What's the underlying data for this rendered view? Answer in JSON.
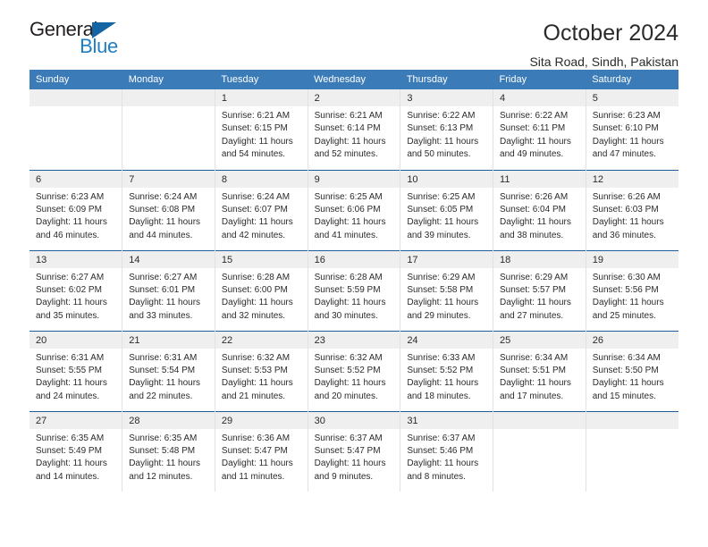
{
  "brand": {
    "name_top": "General",
    "name_bottom": "Blue",
    "triangle_color": "#1264a3",
    "text_color": "#231f20",
    "accent_color": "#1f7fc4"
  },
  "header": {
    "title": "October 2024",
    "location": "Sita Road, Sindh, Pakistan"
  },
  "theme": {
    "header_row_bg": "#3b7cb8",
    "header_row_text": "#ffffff",
    "week_divider": "#1f5e9e",
    "daynum_band_bg": "#efefef",
    "cell_text": "#2b2b2b"
  },
  "weekdays": [
    "Sunday",
    "Monday",
    "Tuesday",
    "Wednesday",
    "Thursday",
    "Friday",
    "Saturday"
  ],
  "weeks": [
    [
      {
        "day": "",
        "lines": []
      },
      {
        "day": "",
        "lines": []
      },
      {
        "day": "1",
        "lines": [
          "Sunrise: 6:21 AM",
          "Sunset: 6:15 PM",
          "Daylight: 11 hours",
          "and 54 minutes."
        ]
      },
      {
        "day": "2",
        "lines": [
          "Sunrise: 6:21 AM",
          "Sunset: 6:14 PM",
          "Daylight: 11 hours",
          "and 52 minutes."
        ]
      },
      {
        "day": "3",
        "lines": [
          "Sunrise: 6:22 AM",
          "Sunset: 6:13 PM",
          "Daylight: 11 hours",
          "and 50 minutes."
        ]
      },
      {
        "day": "4",
        "lines": [
          "Sunrise: 6:22 AM",
          "Sunset: 6:11 PM",
          "Daylight: 11 hours",
          "and 49 minutes."
        ]
      },
      {
        "day": "5",
        "lines": [
          "Sunrise: 6:23 AM",
          "Sunset: 6:10 PM",
          "Daylight: 11 hours",
          "and 47 minutes."
        ]
      }
    ],
    [
      {
        "day": "6",
        "lines": [
          "Sunrise: 6:23 AM",
          "Sunset: 6:09 PM",
          "Daylight: 11 hours",
          "and 46 minutes."
        ]
      },
      {
        "day": "7",
        "lines": [
          "Sunrise: 6:24 AM",
          "Sunset: 6:08 PM",
          "Daylight: 11 hours",
          "and 44 minutes."
        ]
      },
      {
        "day": "8",
        "lines": [
          "Sunrise: 6:24 AM",
          "Sunset: 6:07 PM",
          "Daylight: 11 hours",
          "and 42 minutes."
        ]
      },
      {
        "day": "9",
        "lines": [
          "Sunrise: 6:25 AM",
          "Sunset: 6:06 PM",
          "Daylight: 11 hours",
          "and 41 minutes."
        ]
      },
      {
        "day": "10",
        "lines": [
          "Sunrise: 6:25 AM",
          "Sunset: 6:05 PM",
          "Daylight: 11 hours",
          "and 39 minutes."
        ]
      },
      {
        "day": "11",
        "lines": [
          "Sunrise: 6:26 AM",
          "Sunset: 6:04 PM",
          "Daylight: 11 hours",
          "and 38 minutes."
        ]
      },
      {
        "day": "12",
        "lines": [
          "Sunrise: 6:26 AM",
          "Sunset: 6:03 PM",
          "Daylight: 11 hours",
          "and 36 minutes."
        ]
      }
    ],
    [
      {
        "day": "13",
        "lines": [
          "Sunrise: 6:27 AM",
          "Sunset: 6:02 PM",
          "Daylight: 11 hours",
          "and 35 minutes."
        ]
      },
      {
        "day": "14",
        "lines": [
          "Sunrise: 6:27 AM",
          "Sunset: 6:01 PM",
          "Daylight: 11 hours",
          "and 33 minutes."
        ]
      },
      {
        "day": "15",
        "lines": [
          "Sunrise: 6:28 AM",
          "Sunset: 6:00 PM",
          "Daylight: 11 hours",
          "and 32 minutes."
        ]
      },
      {
        "day": "16",
        "lines": [
          "Sunrise: 6:28 AM",
          "Sunset: 5:59 PM",
          "Daylight: 11 hours",
          "and 30 minutes."
        ]
      },
      {
        "day": "17",
        "lines": [
          "Sunrise: 6:29 AM",
          "Sunset: 5:58 PM",
          "Daylight: 11 hours",
          "and 29 minutes."
        ]
      },
      {
        "day": "18",
        "lines": [
          "Sunrise: 6:29 AM",
          "Sunset: 5:57 PM",
          "Daylight: 11 hours",
          "and 27 minutes."
        ]
      },
      {
        "day": "19",
        "lines": [
          "Sunrise: 6:30 AM",
          "Sunset: 5:56 PM",
          "Daylight: 11 hours",
          "and 25 minutes."
        ]
      }
    ],
    [
      {
        "day": "20",
        "lines": [
          "Sunrise: 6:31 AM",
          "Sunset: 5:55 PM",
          "Daylight: 11 hours",
          "and 24 minutes."
        ]
      },
      {
        "day": "21",
        "lines": [
          "Sunrise: 6:31 AM",
          "Sunset: 5:54 PM",
          "Daylight: 11 hours",
          "and 22 minutes."
        ]
      },
      {
        "day": "22",
        "lines": [
          "Sunrise: 6:32 AM",
          "Sunset: 5:53 PM",
          "Daylight: 11 hours",
          "and 21 minutes."
        ]
      },
      {
        "day": "23",
        "lines": [
          "Sunrise: 6:32 AM",
          "Sunset: 5:52 PM",
          "Daylight: 11 hours",
          "and 20 minutes."
        ]
      },
      {
        "day": "24",
        "lines": [
          "Sunrise: 6:33 AM",
          "Sunset: 5:52 PM",
          "Daylight: 11 hours",
          "and 18 minutes."
        ]
      },
      {
        "day": "25",
        "lines": [
          "Sunrise: 6:34 AM",
          "Sunset: 5:51 PM",
          "Daylight: 11 hours",
          "and 17 minutes."
        ]
      },
      {
        "day": "26",
        "lines": [
          "Sunrise: 6:34 AM",
          "Sunset: 5:50 PM",
          "Daylight: 11 hours",
          "and 15 minutes."
        ]
      }
    ],
    [
      {
        "day": "27",
        "lines": [
          "Sunrise: 6:35 AM",
          "Sunset: 5:49 PM",
          "Daylight: 11 hours",
          "and 14 minutes."
        ]
      },
      {
        "day": "28",
        "lines": [
          "Sunrise: 6:35 AM",
          "Sunset: 5:48 PM",
          "Daylight: 11 hours",
          "and 12 minutes."
        ]
      },
      {
        "day": "29",
        "lines": [
          "Sunrise: 6:36 AM",
          "Sunset: 5:47 PM",
          "Daylight: 11 hours",
          "and 11 minutes."
        ]
      },
      {
        "day": "30",
        "lines": [
          "Sunrise: 6:37 AM",
          "Sunset: 5:47 PM",
          "Daylight: 11 hours",
          "and 9 minutes."
        ]
      },
      {
        "day": "31",
        "lines": [
          "Sunrise: 6:37 AM",
          "Sunset: 5:46 PM",
          "Daylight: 11 hours",
          "and 8 minutes."
        ]
      },
      {
        "day": "",
        "lines": []
      },
      {
        "day": "",
        "lines": []
      }
    ]
  ]
}
